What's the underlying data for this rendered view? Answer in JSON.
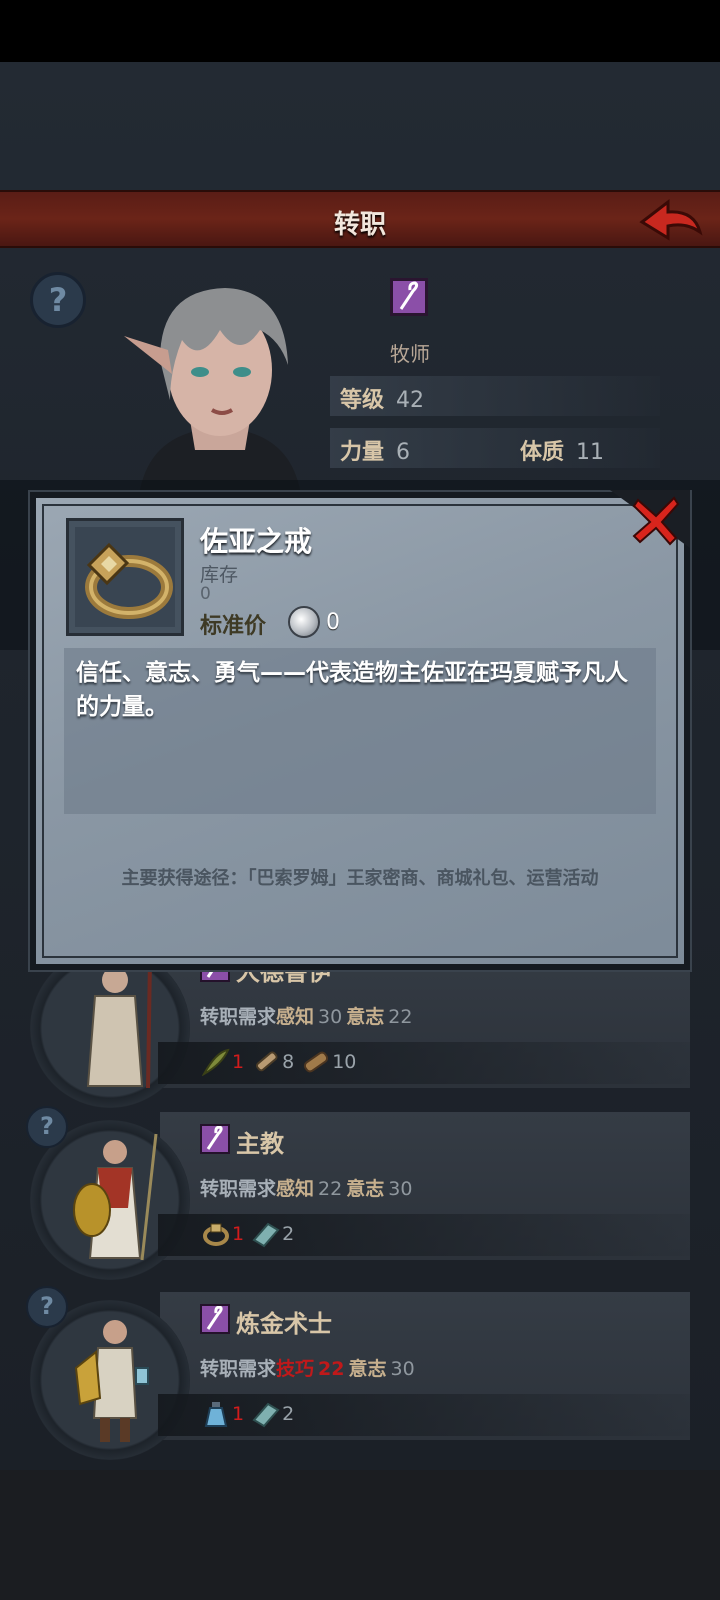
{
  "header": {
    "title": "转职"
  },
  "character": {
    "class_name": "牧师",
    "stats": {
      "level_label": "等级",
      "level_value": "42",
      "strength_label": "力量",
      "strength_value": "6",
      "constitution_label": "体质",
      "constitution_value": "11"
    }
  },
  "item_popup": {
    "name": "佐亚之戒",
    "stock_label": "库存",
    "stock_value": "0",
    "price_label": "标准价",
    "price_value": "0",
    "description": "信任、意志、勇气——代表造物主佐亚在玛夏赋予凡人的力量。",
    "source": "主要获得途径：「巴索罗姆」王家密商、商城礼包、运营活动"
  },
  "jobs": [
    {
      "name": "大德鲁伊",
      "req_label": "转职需求",
      "req1_attr": "感知",
      "req1_value": "30",
      "req1_met": true,
      "req2_attr": "意志",
      "req2_value": "22",
      "req2_met": true,
      "materials": [
        {
          "icon": "herb-icon",
          "count": "1",
          "lacking": true
        },
        {
          "icon": "wood-bundle-icon",
          "count": "8",
          "lacking": false
        },
        {
          "icon": "log-icon",
          "count": "10",
          "lacking": false
        }
      ]
    },
    {
      "name": "主教",
      "req_label": "转职需求",
      "req1_attr": "感知",
      "req1_value": "22",
      "req1_met": true,
      "req2_attr": "意志",
      "req2_value": "30",
      "req2_met": true,
      "materials": [
        {
          "icon": "ring-icon",
          "count": "1",
          "lacking": true
        },
        {
          "icon": "cloth-icon",
          "count": "2",
          "lacking": false
        }
      ]
    },
    {
      "name": "炼金术士",
      "req_label": "转职需求",
      "req1_attr": "技巧",
      "req1_value": "22",
      "req1_met": false,
      "req2_attr": "意志",
      "req2_value": "30",
      "req2_met": true,
      "materials": [
        {
          "icon": "potion-icon",
          "count": "1",
          "lacking": true
        },
        {
          "icon": "cloth-icon",
          "count": "2",
          "lacking": false
        }
      ]
    }
  ],
  "colors": {
    "title_bar": "#6b2418",
    "class_badge": "#8b4fa8",
    "lacking": "#d21c1c",
    "popup_bg": "#8a97a4"
  }
}
